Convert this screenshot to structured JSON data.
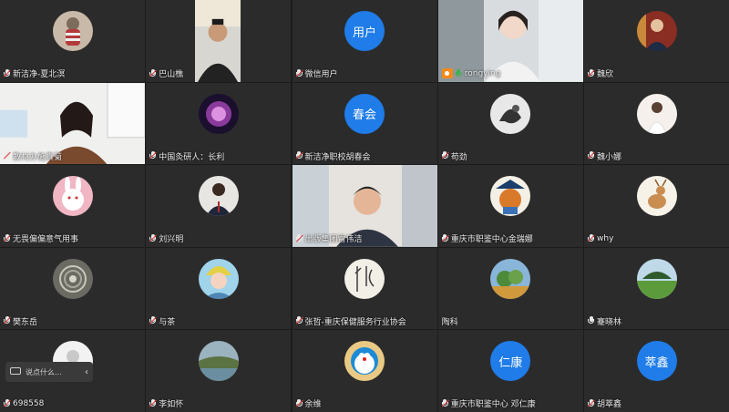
{
  "participants": [
    {
      "name": "新洁净-夏北溟",
      "mic": "muted",
      "type": "image",
      "img": "doll"
    },
    {
      "name": "巴山樵",
      "mic": "muted",
      "type": "video",
      "img": "man-small"
    },
    {
      "name": "微信用户",
      "mic": "muted",
      "type": "text",
      "avatar_text": "用户"
    },
    {
      "name": "rongying",
      "mic": "on",
      "type": "video",
      "img": "woman-office",
      "host": true,
      "active": true
    },
    {
      "name": "魏欣",
      "mic": "muted",
      "type": "image",
      "img": "man-suit"
    },
    {
      "name": "教材办施真菊",
      "mic": "muted",
      "type": "video",
      "img": "woman-home"
    },
    {
      "name": "中国灸研人：长利",
      "mic": "muted",
      "type": "image",
      "img": "purple-logo"
    },
    {
      "name": "新洁净职校胡春会",
      "mic": "muted",
      "type": "text",
      "avatar_text": "春会"
    },
    {
      "name": "苟劲",
      "mic": "muted",
      "type": "image",
      "img": "gray-swirl"
    },
    {
      "name": "魏小娜",
      "mic": "muted",
      "type": "image",
      "img": "bride"
    },
    {
      "name": "无畏偏偏意气用事",
      "mic": "muted",
      "type": "image",
      "img": "bunny"
    },
    {
      "name": "刘兴明",
      "mic": "muted",
      "type": "image",
      "img": "man-tie"
    },
    {
      "name": "出版集团雷伟洁",
      "mic": "muted",
      "type": "video",
      "img": "man-desk"
    },
    {
      "name": "重庆市职鉴中心金瑞娜",
      "mic": "muted",
      "type": "image",
      "img": "cat-hat"
    },
    {
      "name": "why",
      "mic": "muted",
      "type": "image",
      "img": "deer"
    },
    {
      "name": "樊东岳",
      "mic": "muted",
      "type": "image",
      "img": "shell"
    },
    {
      "name": "与茶",
      "mic": "muted",
      "type": "image",
      "img": "girl-art"
    },
    {
      "name": "张哲-重庆保健服务行业协会",
      "mic": "muted",
      "type": "image",
      "img": "calligraphy"
    },
    {
      "name": "陶科",
      "mic": "none",
      "type": "image",
      "img": "landscape"
    },
    {
      "name": "蹇晓林",
      "mic": "plain",
      "type": "image",
      "img": "field"
    },
    {
      "name": "698558",
      "mic": "muted",
      "type": "image",
      "img": "default"
    },
    {
      "name": "李如怀",
      "mic": "muted",
      "type": "image",
      "img": "lake"
    },
    {
      "name": "余维",
      "mic": "muted",
      "type": "image",
      "img": "doraemon"
    },
    {
      "name": "重庆市职鉴中心 邓仁康",
      "mic": "muted",
      "type": "text",
      "avatar_text": "仁康"
    },
    {
      "name": "胡萃鑫",
      "mic": "muted",
      "type": "text",
      "avatar_text": "萃鑫"
    }
  ],
  "chat_input": {
    "placeholder": "说点什么..."
  },
  "colors": {
    "accent": "#1f7ce8",
    "active": "#3fb14f",
    "muted": "#e23c3c"
  }
}
